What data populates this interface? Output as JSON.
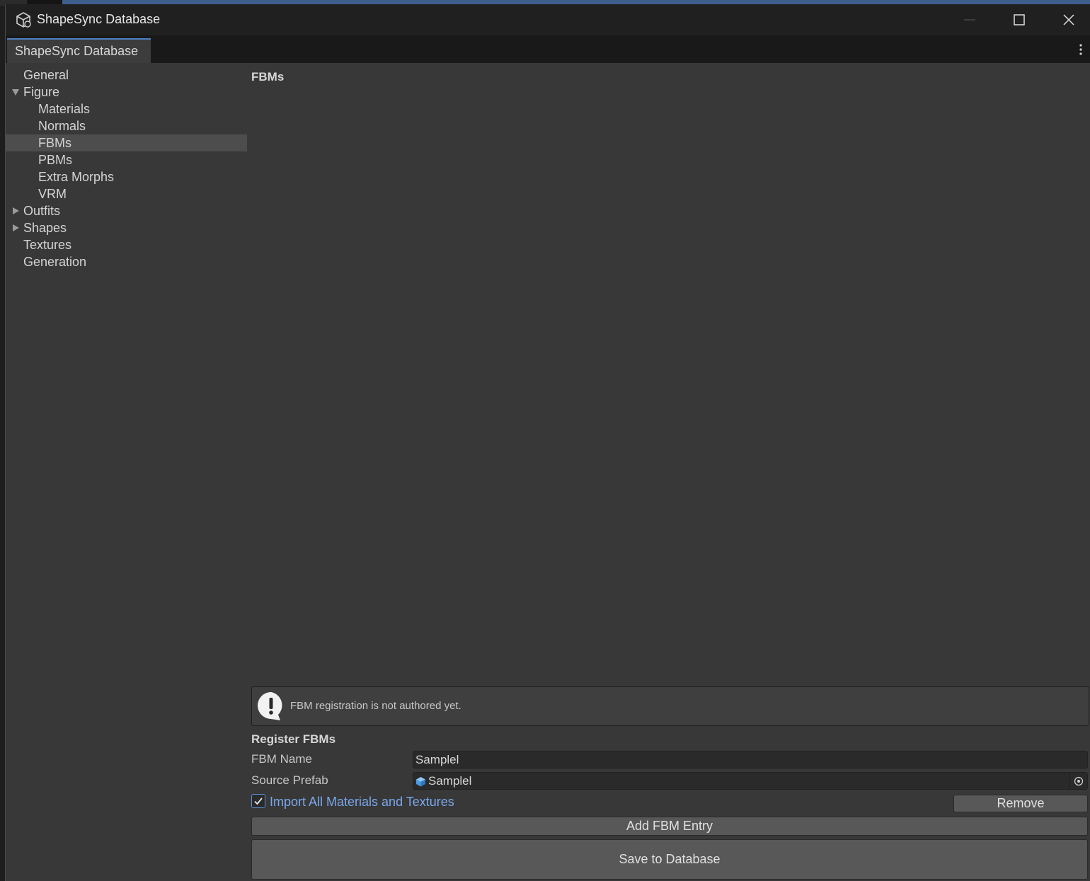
{
  "window": {
    "title": "ShapeSync Database",
    "tab_label": "ShapeSync Database"
  },
  "sidebar": {
    "items": [
      {
        "label": "General",
        "indent": 0,
        "expander": "none",
        "selected": false
      },
      {
        "label": "Figure",
        "indent": 0,
        "expander": "expanded",
        "selected": false
      },
      {
        "label": "Materials",
        "indent": 1,
        "expander": "none",
        "selected": false
      },
      {
        "label": "Normals",
        "indent": 1,
        "expander": "none",
        "selected": false
      },
      {
        "label": "FBMs",
        "indent": 1,
        "expander": "none",
        "selected": true
      },
      {
        "label": "PBMs",
        "indent": 1,
        "expander": "none",
        "selected": false
      },
      {
        "label": "Extra Morphs",
        "indent": 1,
        "expander": "none",
        "selected": false
      },
      {
        "label": "VRM",
        "indent": 1,
        "expander": "none",
        "selected": false
      },
      {
        "label": "Outfits",
        "indent": 0,
        "expander": "collapsed",
        "selected": false
      },
      {
        "label": "Shapes",
        "indent": 0,
        "expander": "collapsed",
        "selected": false
      },
      {
        "label": "Textures",
        "indent": 0,
        "expander": "none",
        "selected": false
      },
      {
        "label": "Generation",
        "indent": 0,
        "expander": "none",
        "selected": false
      }
    ]
  },
  "content": {
    "section_title": "FBMs",
    "help_message": "FBM registration is not authored yet.",
    "register_title": "Register FBMs",
    "fbm_name_label": "FBM Name",
    "fbm_name_value": "Samplel",
    "source_prefab_label": "Source Prefab",
    "source_prefab_value": "Samplel",
    "import_all_label": "Import All Materials and Textures",
    "import_all_checked": true,
    "remove_label": "Remove",
    "add_entry_label": "Add FBM Entry",
    "save_label": "Save to Database"
  },
  "colors": {
    "accent": "#4c7fc0",
    "link_text": "#7aa7ec",
    "panel_bg": "#383838",
    "selected_row": "#4d4d4d"
  }
}
